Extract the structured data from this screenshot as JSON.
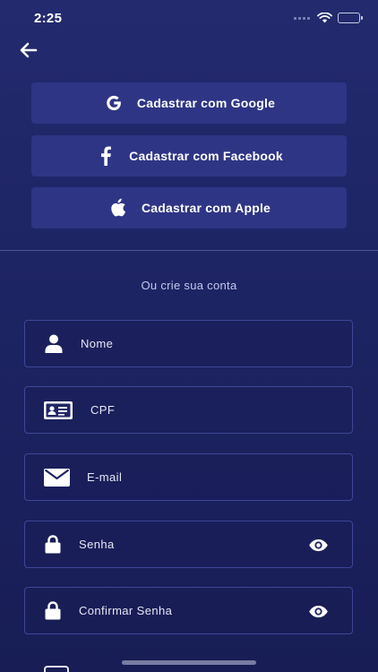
{
  "status_bar": {
    "time": "2:25"
  },
  "social_buttons": [
    {
      "label": "Cadastrar com Google",
      "icon": "google-icon"
    },
    {
      "label": "Cadastrar com Facebook",
      "icon": "facebook-icon"
    },
    {
      "label": "Cadastrar com Apple",
      "icon": "apple-icon"
    }
  ],
  "form": {
    "subtitle": "Ou crie sua conta",
    "fields": [
      {
        "placeholder": "Nome",
        "icon": "user-icon"
      },
      {
        "placeholder": "CPF",
        "icon": "id-card-icon"
      },
      {
        "placeholder": "E-mail",
        "icon": "envelope-icon"
      },
      {
        "placeholder": "Senha",
        "icon": "lock-icon",
        "toggle_icon": "eye-icon"
      },
      {
        "placeholder": "Confirmar Senha",
        "icon": "lock-icon",
        "toggle_icon": "eye-icon"
      }
    ]
  },
  "colors": {
    "background": "#1d2463",
    "button_background": "#2f3585",
    "field_border": "#3f4797",
    "text": "#ffffff",
    "subtitle_text": "#c5c8ec"
  }
}
